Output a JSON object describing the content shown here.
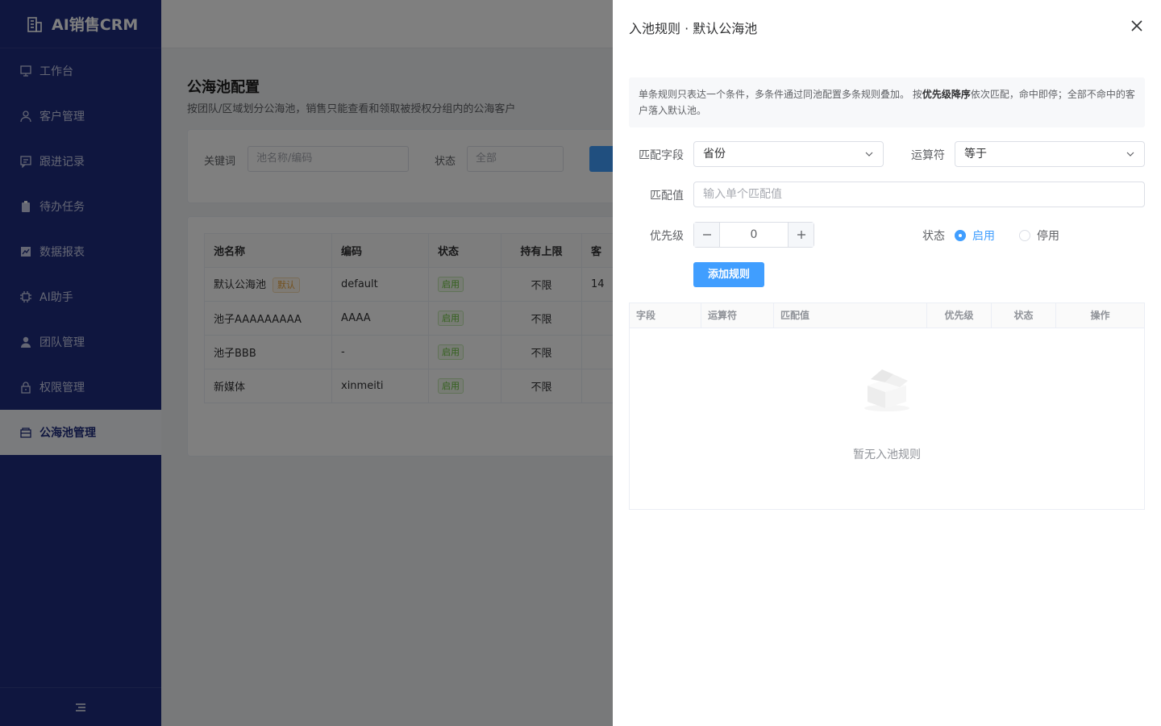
{
  "app": {
    "title": "AI销售CRM"
  },
  "sidebar": {
    "items": [
      {
        "label": "工作台",
        "icon": "dashboard-icon"
      },
      {
        "label": "客户管理",
        "icon": "user-icon"
      },
      {
        "label": "跟进记录",
        "icon": "message-icon"
      },
      {
        "label": "待办任务",
        "icon": "clipboard-icon"
      },
      {
        "label": "数据报表",
        "icon": "chart-icon"
      },
      {
        "label": "AI助手",
        "icon": "chip-icon"
      },
      {
        "label": "团队管理",
        "icon": "person-icon"
      },
      {
        "label": "权限管理",
        "icon": "lock-icon"
      },
      {
        "label": "公海池管理",
        "icon": "box-icon",
        "active": true
      }
    ],
    "collapse_icon": "menu-fold-icon"
  },
  "page": {
    "title": "公海池配置",
    "subtitle": "按团队/区域划分公海池，销售只能查看和领取被授权分组内的公海客户",
    "filter": {
      "keyword_label": "关键词",
      "keyword_placeholder": "池名称/编码",
      "status_label": "状态",
      "status_value": "全部"
    },
    "table": {
      "headers": [
        "池名称",
        "编码",
        "状态",
        "持有上限",
        "客"
      ],
      "rows": [
        {
          "name": "默认公海池",
          "tag": "默认",
          "code": "default",
          "status": "启用",
          "limit": "不限",
          "extra": "14"
        },
        {
          "name": "池子AAAAAAAAA",
          "tag": "",
          "code": "AAAA",
          "status": "启用",
          "limit": "不限",
          "extra": ""
        },
        {
          "name": "池子BBB",
          "tag": "",
          "code": "-",
          "status": "启用",
          "limit": "不限",
          "extra": ""
        },
        {
          "name": "新媒体",
          "tag": "",
          "code": "xinmeiti",
          "status": "启用",
          "limit": "不限",
          "extra": ""
        }
      ]
    }
  },
  "drawer": {
    "title": "入池规则 · 默认公海池",
    "tip_part1": "单条规则只表达一个条件，多条件通过同池配置多条规则叠加。 按",
    "tip_bold": "优先级降序",
    "tip_part2": "依次匹配，命中即停；全部不命中的客户落入默认池。",
    "form": {
      "field_label": "匹配字段",
      "field_value": "省份",
      "operator_label": "运算符",
      "operator_value": "等于",
      "value_label": "匹配值",
      "value_placeholder": "输入单个匹配值",
      "priority_label": "优先级",
      "priority_value": "0",
      "status_label": "状态",
      "status_on": "启用",
      "status_off": "停用",
      "status_selected": "启用",
      "add_button": "添加规则"
    },
    "rules_table": {
      "headers": [
        "字段",
        "运算符",
        "匹配值",
        "优先级",
        "状态",
        "操作"
      ],
      "empty_text": "暂无入池规则"
    }
  },
  "colors": {
    "sidebar_bg": "#1f2d7e",
    "primary": "#409eff",
    "success": "#67c23a",
    "warning": "#e6a23c"
  }
}
